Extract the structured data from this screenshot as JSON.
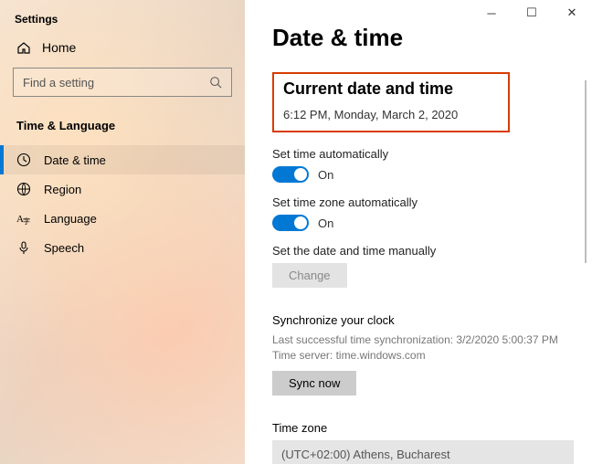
{
  "window": {
    "title": "Settings"
  },
  "sidebar": {
    "home": "Home",
    "search_placeholder": "Find a setting",
    "category": "Time & Language",
    "items": [
      {
        "label": "Date & time"
      },
      {
        "label": "Region"
      },
      {
        "label": "Language"
      },
      {
        "label": "Speech"
      }
    ]
  },
  "main": {
    "page_title": "Date & time",
    "current_heading": "Current date and time",
    "current_value": "6:12 PM, Monday, March 2, 2020",
    "auto_time_label": "Set time automatically",
    "auto_time_state": "On",
    "auto_tz_label": "Set time zone automatically",
    "auto_tz_state": "On",
    "manual_label": "Set the date and time manually",
    "change_btn": "Change",
    "sync_heading": "Synchronize your clock",
    "sync_last": "Last successful time synchronization: 3/2/2020 5:00:37 PM",
    "sync_server": "Time server: time.windows.com",
    "sync_btn": "Sync now",
    "tz_heading": "Time zone",
    "tz_value": "(UTC+02:00) Athens, Bucharest"
  }
}
